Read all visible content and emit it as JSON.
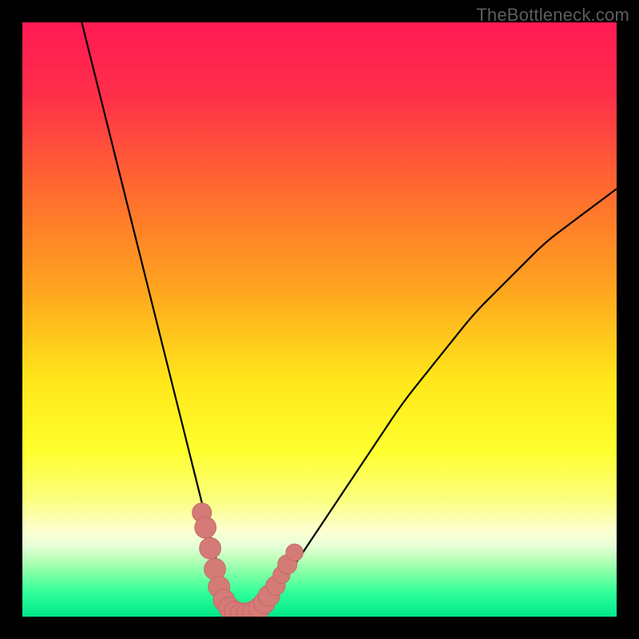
{
  "watermark": "TheBottleneck.com",
  "colors": {
    "gradient_stops": [
      {
        "offset": 0.0,
        "color": "#ff1a53"
      },
      {
        "offset": 0.12,
        "color": "#ff2e4a"
      },
      {
        "offset": 0.28,
        "color": "#ff6a2f"
      },
      {
        "offset": 0.45,
        "color": "#ffa51f"
      },
      {
        "offset": 0.6,
        "color": "#ffe61a"
      },
      {
        "offset": 0.72,
        "color": "#ffff2e"
      },
      {
        "offset": 0.8,
        "color": "#fbff7a"
      },
      {
        "offset": 0.855,
        "color": "#fdffd0"
      },
      {
        "offset": 0.88,
        "color": "#e8ffd8"
      },
      {
        "offset": 0.905,
        "color": "#b6ffb8"
      },
      {
        "offset": 0.93,
        "color": "#7affa3"
      },
      {
        "offset": 0.96,
        "color": "#30ff9a"
      },
      {
        "offset": 1.0,
        "color": "#00e88a"
      }
    ],
    "curve": "#000000",
    "marker_fill": "#d47b77",
    "marker_stroke": "#c46b67"
  },
  "chart_data": {
    "type": "line",
    "title": "",
    "xlabel": "",
    "ylabel": "",
    "xlim": [
      0,
      100
    ],
    "ylim": [
      0,
      100
    ],
    "series": [
      {
        "name": "bottleneck-curve",
        "x": [
          10,
          12,
          14,
          16,
          18,
          20,
          22,
          24,
          26,
          28,
          30,
          32,
          33.5,
          35,
          37,
          39,
          41,
          44,
          48,
          52,
          56,
          60,
          64,
          68,
          72,
          76,
          80,
          84,
          88,
          92,
          96,
          100
        ],
        "y": [
          100,
          92,
          84,
          76,
          68,
          60,
          52,
          44,
          36,
          28,
          20,
          12,
          6,
          2,
          0,
          0,
          2,
          6,
          12,
          18,
          24,
          30,
          36,
          41,
          46,
          51,
          55,
          59,
          63,
          66,
          69,
          72
        ]
      }
    ],
    "markers": {
      "name": "highlight-points",
      "points": [
        {
          "x": 30.2,
          "y": 17.5,
          "r": 1.2
        },
        {
          "x": 30.8,
          "y": 15.0,
          "r": 1.4
        },
        {
          "x": 31.6,
          "y": 11.5,
          "r": 1.4
        },
        {
          "x": 32.4,
          "y": 8.0,
          "r": 1.4
        },
        {
          "x": 33.1,
          "y": 5.0,
          "r": 1.4
        },
        {
          "x": 33.9,
          "y": 2.8,
          "r": 1.4
        },
        {
          "x": 34.8,
          "y": 1.5,
          "r": 1.4
        },
        {
          "x": 35.8,
          "y": 0.8,
          "r": 1.4
        },
        {
          "x": 36.8,
          "y": 0.5,
          "r": 1.4
        },
        {
          "x": 37.8,
          "y": 0.5,
          "r": 1.4
        },
        {
          "x": 38.8,
          "y": 0.8,
          "r": 1.4
        },
        {
          "x": 39.8,
          "y": 1.4,
          "r": 1.4
        },
        {
          "x": 40.7,
          "y": 2.3,
          "r": 1.4
        },
        {
          "x": 41.5,
          "y": 3.5,
          "r": 1.4
        },
        {
          "x": 42.6,
          "y": 5.2,
          "r": 1.2
        },
        {
          "x": 43.6,
          "y": 7.0,
          "r": 1.0
        },
        {
          "x": 44.6,
          "y": 8.8,
          "r": 1.2
        },
        {
          "x": 45.8,
          "y": 10.8,
          "r": 1.0
        }
      ]
    }
  }
}
